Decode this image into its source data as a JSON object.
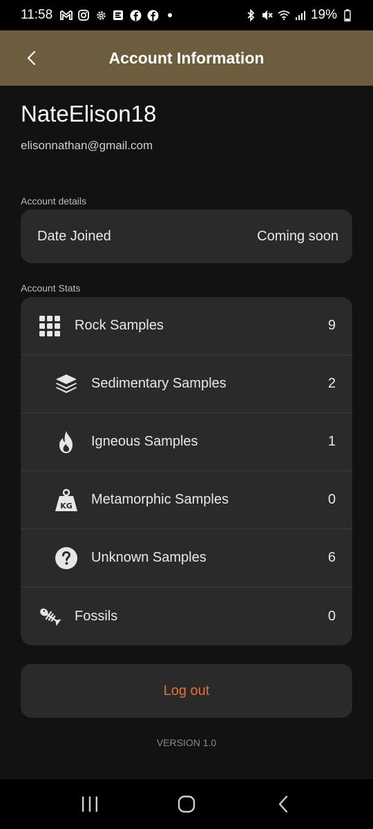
{
  "status_bar": {
    "time": "11:58",
    "battery": "19%",
    "icons_left": [
      "gmail-icon",
      "instagram-icon",
      "settings-icon",
      "app-icon",
      "facebook-icon",
      "facebook-icon",
      "dot-icon"
    ],
    "icons_right": [
      "bluetooth-icon",
      "mute-icon",
      "wifi-icon",
      "signal-icon",
      "battery-icon"
    ]
  },
  "app_bar": {
    "title": "Account Information",
    "background": "#6b5d3e"
  },
  "profile": {
    "username": "NateElison18",
    "email": "elisonnathan@gmail.com"
  },
  "account_details": {
    "label": "Account details",
    "rows": [
      {
        "label": "Date Joined",
        "value": "Coming soon"
      }
    ]
  },
  "account_stats": {
    "label": "Account Stats",
    "rows": [
      {
        "label": "Rock Samples",
        "value": "9",
        "icon": "grid-icon"
      },
      {
        "label": "Sedimentary Samples",
        "value": "2",
        "icon": "layers-icon"
      },
      {
        "label": "Igneous Samples",
        "value": "1",
        "icon": "fire-icon"
      },
      {
        "label": "Metamorphic Samples",
        "value": "0",
        "icon": "weight-icon"
      },
      {
        "label": "Unknown Samples",
        "value": "6",
        "icon": "question-icon"
      },
      {
        "label": "Fossils",
        "value": "0",
        "icon": "fish-bone-icon"
      }
    ]
  },
  "logout": {
    "label": "Log out",
    "color": "#e3703f"
  },
  "footer": {
    "version": "VERSION 1.0"
  }
}
